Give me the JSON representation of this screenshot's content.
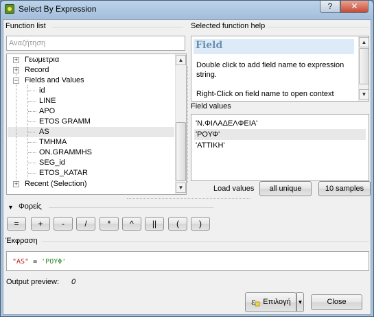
{
  "window": {
    "title": "Select By Expression",
    "help_button": "?",
    "close_button": "✕"
  },
  "function_list": {
    "label": "Function list",
    "search_placeholder": "Αναζήτηση",
    "tree": [
      {
        "label": "Γεωμετρια",
        "expander": "+"
      },
      {
        "label": "Record",
        "expander": "+"
      },
      {
        "label": "Fields and Values",
        "expander": "−"
      },
      {
        "label": "id"
      },
      {
        "label": "LINE"
      },
      {
        "label": "APO"
      },
      {
        "label": "ETOS GRAMM"
      },
      {
        "label": "AS"
      },
      {
        "label": "TMHMA"
      },
      {
        "label": "ON.GRAMMHS"
      },
      {
        "label": "SEG_id"
      },
      {
        "label": "ETOS_KATAR"
      },
      {
        "label": "Recent (Selection)",
        "expander": "+"
      }
    ]
  },
  "help": {
    "label": "Selected function help",
    "title": "Field",
    "line1": "Double click to add field name to expression string.",
    "line2": "Right-Click on field name to open context menu"
  },
  "field_values": {
    "label": "Field values",
    "values": [
      "'Ν.ΦΙΛΑΔΕΛΦΕΙΑ'",
      "'ΡΟΥΦ'",
      "'ΑΤΤΙΚΗ'"
    ],
    "load_label": "Load values",
    "all_unique": "all unique",
    "ten_samples": "10 samples"
  },
  "operators": {
    "label": "Φορείς",
    "collapse_arrow": "▼",
    "items": [
      "=",
      "+",
      "-",
      "/",
      "*",
      "^",
      "||",
      "(",
      ")"
    ]
  },
  "expression": {
    "label": "Έκφραση",
    "field": "\"AS\"",
    "op": " = ",
    "value": "'ΡΟΥΦ'"
  },
  "output": {
    "label": "Output preview:",
    "value": "0"
  },
  "buttons": {
    "select": "Επιλογή",
    "close": "Close",
    "dropdown_arrow": "▼"
  }
}
